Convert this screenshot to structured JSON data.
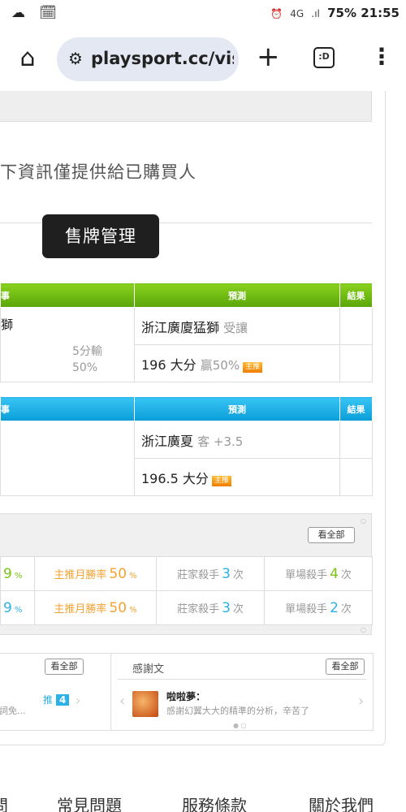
{
  "status": {
    "left_icons": "☁ 🗓",
    "network": "4G",
    "battery": "75%",
    "time": "21:55"
  },
  "browser": {
    "url": "playsport.cc/vis",
    "home_icon": "home-icon",
    "plus_icon": "plus-icon",
    "tabs_count": ":D",
    "menu_icon": "more-vertical-icon"
  },
  "notice": "下資訊僅提供給已購買人",
  "sell_button": "售牌管理",
  "table1": {
    "header_col1": "事",
    "header_col2": "預測",
    "header_col3": "結果",
    "row1_left": "獅",
    "row1_pred_main": "浙江廣廈猛獅",
    "row1_pred_note": "受讓",
    "row2_left_extra": "5分輸",
    "row2_left_pct": "50%",
    "row2_pred_main": "196 大分",
    "row2_pred_note": "贏50%",
    "tag": "主推"
  },
  "table2": {
    "header_col1": "事",
    "header_col2": "預測",
    "header_col3": "結果",
    "row1_pred_main": "浙江廣夏",
    "row1_pred_note": "客 +3.5",
    "row2_pred_main": "196.5 大分",
    "tag": "主推"
  },
  "stats": {
    "see_all": "看全部",
    "rows": [
      {
        "c1_val": "9",
        "c1_unit": "%",
        "c2_label": "主推月勝率",
        "c2_val": "50",
        "c2_unit": "%",
        "c3_label": "莊家殺手",
        "c3_val": "3",
        "c3_unit": "次",
        "c4_label": "單場殺手",
        "c4_val": "4",
        "c4_unit": "次"
      },
      {
        "c1_val": "9",
        "c1_unit": "%",
        "c2_label": "主推月勝率",
        "c2_val": "50",
        "c2_unit": "%",
        "c3_label": "莊家殺手",
        "c3_val": "3",
        "c3_unit": "次",
        "c4_label": "單場殺手",
        "c4_val": "2",
        "c4_unit": "次"
      }
    ]
  },
  "left_box": {
    "see_all": "看全部",
    "text": "詞免...",
    "push_label": "推",
    "push_count": "4"
  },
  "thanks_box": {
    "title": "感謝文",
    "see_all": "看全部",
    "username": "啦啦夢：",
    "message": "感謝幻翼大大的精準的分析，辛苦了"
  },
  "footer": {
    "links": [
      "問",
      "常見問題",
      "服務條款",
      "關於我們"
    ]
  }
}
